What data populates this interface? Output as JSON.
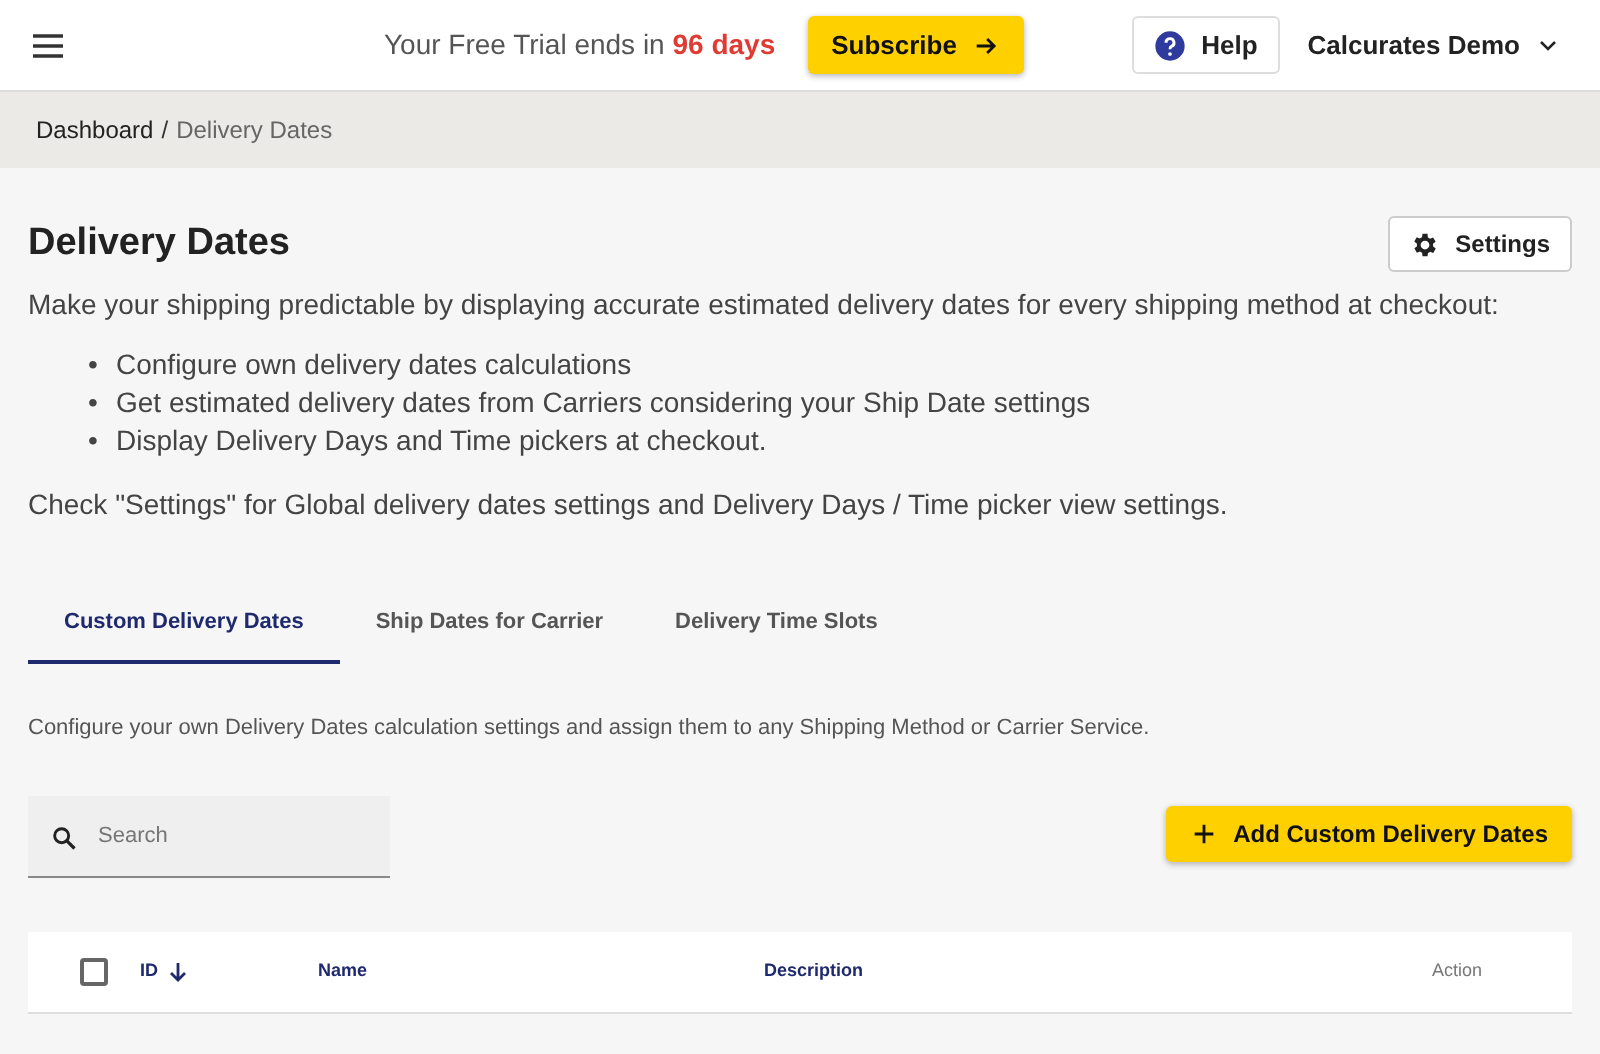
{
  "topbar": {
    "trial": {
      "text": "Your Free Trial ends in",
      "highlight": "96 days"
    },
    "subscribe": "Subscribe",
    "help": "Help",
    "account": "Calcurates Demo"
  },
  "breadcrumb": {
    "separator": "/",
    "items": [
      {
        "label": "Dashboard",
        "current": false
      },
      {
        "label": "Delivery Dates",
        "current": true
      }
    ]
  },
  "page": {
    "title": "Delivery Dates",
    "settings": "Settings",
    "intro": "Make your shipping predictable by displaying accurate estimated delivery dates for every shipping method at checkout:",
    "bullets": [
      {
        "marker": "•",
        "text": "Configure own delivery dates calculations"
      },
      {
        "marker": "•",
        "text": "Get estimated delivery dates from Carriers considering your Ship Date settings"
      },
      {
        "marker": "•",
        "text": "Display Delivery Days and Time pickers at checkout."
      }
    ],
    "note": "Check \"Settings\" for Global delivery dates settings and Delivery Days / Time picker view settings."
  },
  "tabs": [
    {
      "label": "Custom Delivery Dates",
      "selected": true
    },
    {
      "label": "Ship Dates for Carrier",
      "selected": false
    },
    {
      "label": "Delivery Time Slots",
      "selected": false
    }
  ],
  "tab_description": "Configure your own Delivery Dates calculation settings and assign them to any Shipping Method or Carrier Service.",
  "search": {
    "placeholder": "Search"
  },
  "add_button": "Add Custom Delivery Dates",
  "table": {
    "select_all": {
      "checked": false
    },
    "columns": [
      {
        "label": "ID",
        "kind": "sorted"
      },
      {
        "label": "Name",
        "kind": "data"
      },
      {
        "label": "Description",
        "kind": "data"
      },
      {
        "label": "Action",
        "kind": "action"
      }
    ]
  }
}
